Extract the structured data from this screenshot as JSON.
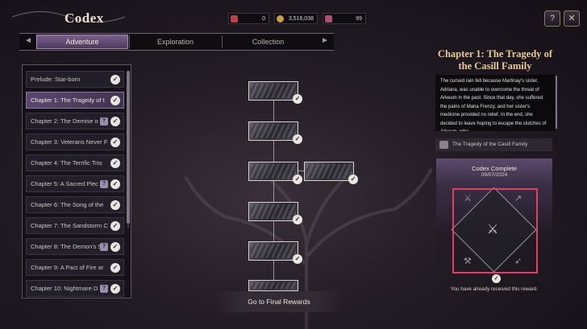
{
  "header": {
    "title": "Codex",
    "resources": [
      {
        "icon": "gem-icon",
        "value": "0",
        "color": "#c0404a"
      },
      {
        "icon": "gold-coin-icon",
        "value": "3,516,038",
        "color": "#c8a040"
      },
      {
        "icon": "crystal-icon",
        "value": "99",
        "color": "#b05070"
      }
    ],
    "buttons": [
      {
        "icon": "help-book-icon",
        "glyph": "?"
      },
      {
        "icon": "close-icon",
        "glyph": "✕"
      }
    ]
  },
  "tabs": [
    {
      "label": "Adventure",
      "active": true
    },
    {
      "label": "Exploration",
      "active": false
    },
    {
      "label": "Collection",
      "active": false
    }
  ],
  "chapters": [
    {
      "label": "Prelude: Star-born",
      "completed": true,
      "active": false,
      "hint": false
    },
    {
      "label": "Chapter 1: The Tragedy of t",
      "completed": true,
      "active": true,
      "hint": false
    },
    {
      "label": "Chapter 2: The Demise o",
      "completed": true,
      "active": false,
      "hint": true
    },
    {
      "label": "Chapter 3: Veterans Never F",
      "completed": true,
      "active": false,
      "hint": false
    },
    {
      "label": "Chapter 4: The Terrific Trio",
      "completed": true,
      "active": false,
      "hint": false
    },
    {
      "label": "Chapter 5: A Sacred Plec",
      "completed": true,
      "active": false,
      "hint": true
    },
    {
      "label": "Chapter 6: The Song of the",
      "completed": true,
      "active": false,
      "hint": false
    },
    {
      "label": "Chapter 7: The Sandstorm C",
      "completed": true,
      "active": false,
      "hint": false
    },
    {
      "label": "Chapter 8: The Demon's Sm",
      "completed": true,
      "active": false,
      "hint": true
    },
    {
      "label": "Chapter 9: A Pact of Fire ar",
      "completed": true,
      "active": false,
      "hint": false
    },
    {
      "label": "Chapter 10: Nightmare D",
      "completed": true,
      "active": false,
      "hint": true
    }
  ],
  "main": {
    "final_rewards_label": "Go to Final Rewards"
  },
  "detail": {
    "title": "Chapter 1: The Tragedy of the Casill Family",
    "story": "The cursed rain fell because Martinay's sister, Adriana, was unable to overcome the threat of Arkeum in the past. Since that day, she suffered the pains of Mana Frenzy, and her sister's medicine provided no relief. In the end, she decided to leave hoping to escape the clutches of Arkeum, who",
    "story_tag": "The Tragedy of the Casill Family",
    "codex_complete": "Codex Complete",
    "codex_date": "09/07/2024",
    "reward_note": "You have already received this reward.",
    "highlight_color": "#e63c63"
  }
}
